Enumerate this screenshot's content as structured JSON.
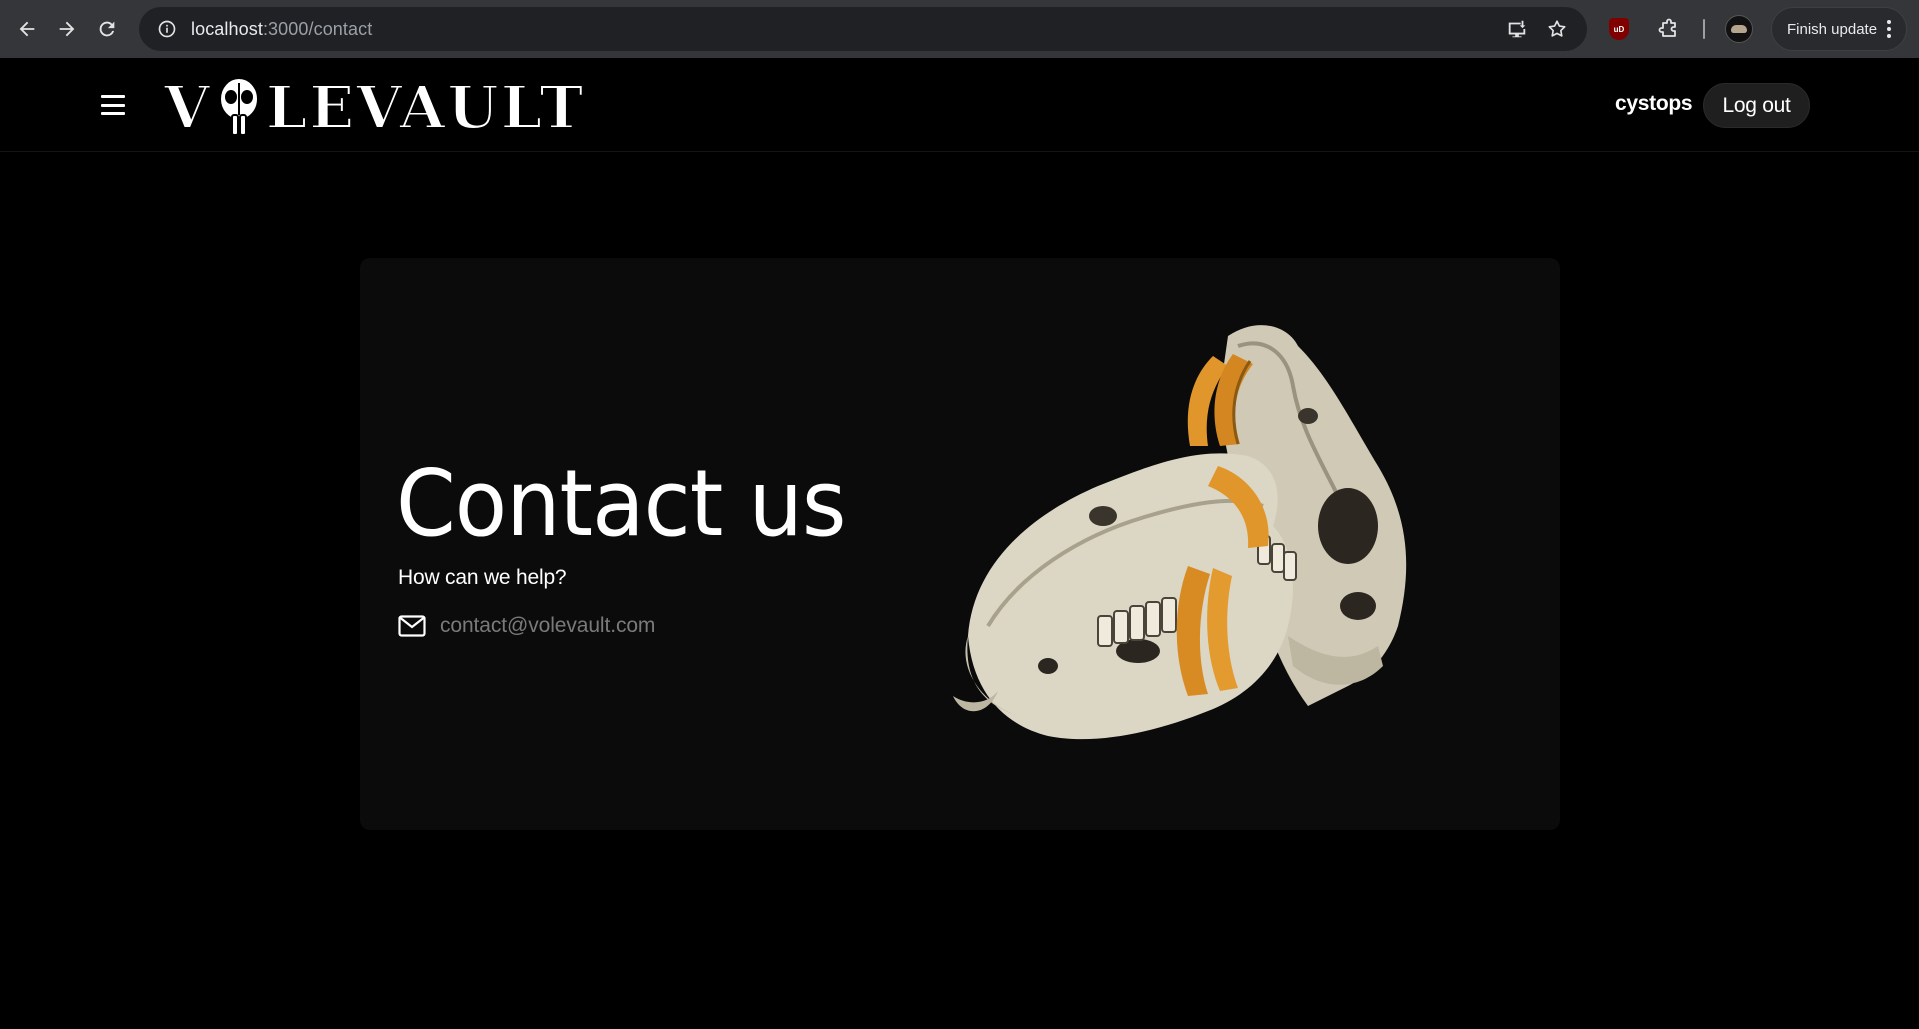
{
  "browser": {
    "url_host": "localhost",
    "url_path": ":3000/contact",
    "finish_update_label": "Finish update",
    "icons": [
      "back-arrow-icon",
      "forward-arrow-icon",
      "reload-icon",
      "info-icon",
      "install-app-icon",
      "bookmark-star-icon",
      "ublock-extension-icon",
      "extensions-puzzle-icon",
      "profile-avatar-icon",
      "more-vert-icon"
    ],
    "ublock_badge": "uD"
  },
  "header": {
    "logo_text_left": "V",
    "logo_text_right": "LEVAULT",
    "username": "cystops",
    "logout_label": "Log out",
    "menu_icon": "hamburger-menu-icon"
  },
  "contact": {
    "title": "Contact us",
    "subtitle": "How can we help?",
    "email": "contact@volevault.com",
    "email_icon": "mail-icon"
  },
  "colors": {
    "page_background": "#000000",
    "card_background": "#0b0b0b",
    "email_text": "#7a7a7a",
    "tooth_orange": "#e0962a",
    "bone": "#d9d4c4"
  }
}
